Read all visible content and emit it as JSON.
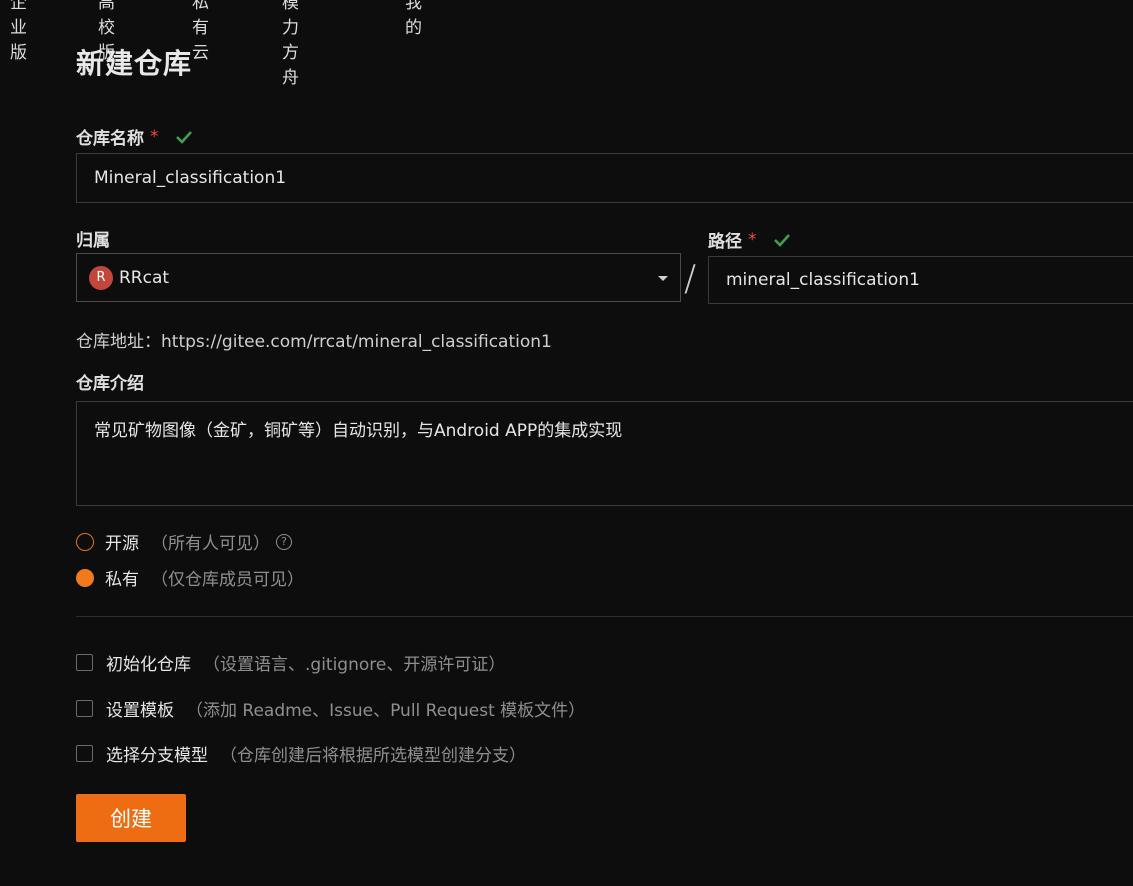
{
  "top_nav": [
    "企业版",
    "高校版",
    "私有云",
    "模力方舟",
    "我的"
  ],
  "page_title": "新建仓库",
  "repo_name": {
    "label": "仓库名称",
    "required": "*",
    "value": "Mineral_classification1"
  },
  "owner": {
    "label": "归属",
    "avatar_letter": "R",
    "value": "RRcat"
  },
  "separator": "/",
  "path": {
    "label": "路径",
    "required": "*",
    "value": "mineral_classification1"
  },
  "repo_address": "仓库地址：https://gitee.com/rrcat/mineral_classification1",
  "description": {
    "label": "仓库介绍",
    "value": "常见矿物图像（金矿，铜矿等）自动识别，与Android APP的集成实现"
  },
  "visibility": {
    "public": {
      "label": "开源",
      "hint": "（所有人可见）",
      "help": "?"
    },
    "private": {
      "label": "私有",
      "hint": "（仅仓库成员可见）"
    }
  },
  "options": [
    {
      "label": "初始化仓库",
      "hint": "（设置语言、.gitignore、开源许可证）"
    },
    {
      "label": "设置模板",
      "hint": "（添加 Readme、Issue、Pull Request 模板文件）"
    },
    {
      "label": "选择分支模型",
      "hint": "（仓库创建后将根据所选模型创建分支）"
    }
  ],
  "submit_label": "创建",
  "colors": {
    "accent": "#ef6d12",
    "valid_check": "#3fa14f",
    "required": "#f04848",
    "background": "#0d0d0d"
  }
}
